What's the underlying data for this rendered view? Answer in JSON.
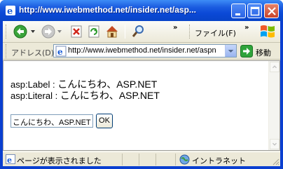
{
  "window": {
    "title": "http://www.iwebmethod.net/insider.net/asp...",
    "titlebar_color": "#0a48d6"
  },
  "toolbar": {
    "back_icon": "back-arrow-icon",
    "forward_icon": "forward-arrow-icon",
    "stop_icon": "stop-icon",
    "refresh_icon": "refresh-icon",
    "home_icon": "home-icon",
    "search_icon": "search-icon",
    "overflow_1": "»",
    "file_menu": "ファイル(F)",
    "overflow_2": "»"
  },
  "address_bar": {
    "label": "アドレス(D)",
    "url": "http://www.iwebmethod.net/insider.net/aspn",
    "go_label": "移動"
  },
  "content": {
    "label_line_prefix": "asp:Label : ",
    "label_line_value": "こんにちわ、ASP.NET",
    "literal_line_prefix": "asp:Literal : ",
    "literal_line_value": "こんにちわ、ASP.NET",
    "textbox_value": "こんにちわ、ASP.NET",
    "ok_button": "OK"
  },
  "status_bar": {
    "status_text": "ページが表示されました",
    "zone_text": "イントラネット"
  }
}
